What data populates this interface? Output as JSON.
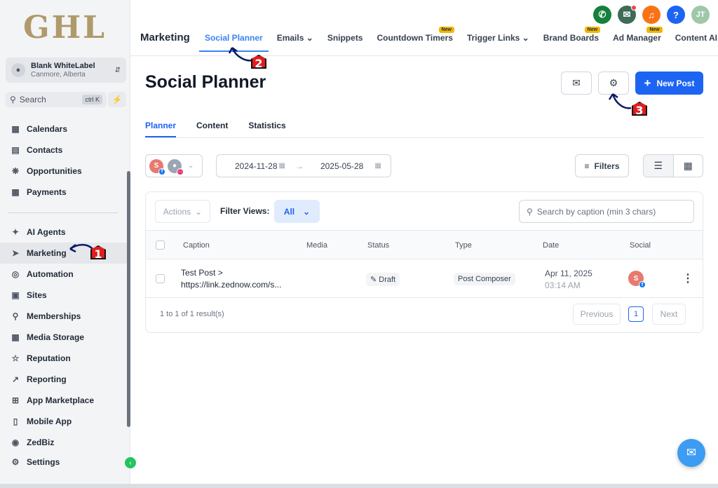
{
  "sidebar": {
    "logo": "GHL",
    "account": {
      "name": "Blank WhiteLabel",
      "location": "Canmore, Alberta"
    },
    "search": {
      "label": "Search",
      "shortcut": "ctrl K"
    },
    "items": [
      {
        "label": "Calendars",
        "icon": "calendar-icon"
      },
      {
        "label": "Contacts",
        "icon": "contacts-icon"
      },
      {
        "label": "Opportunities",
        "icon": "opportunities-icon"
      },
      {
        "label": "Payments",
        "icon": "payments-icon"
      },
      {
        "label": "AI Agents",
        "icon": "sparkle-icon"
      },
      {
        "label": "Marketing",
        "icon": "send-icon"
      },
      {
        "label": "Automation",
        "icon": "automation-icon"
      },
      {
        "label": "Sites",
        "icon": "sites-icon"
      },
      {
        "label": "Memberships",
        "icon": "award-icon"
      },
      {
        "label": "Media Storage",
        "icon": "image-icon"
      },
      {
        "label": "Reputation",
        "icon": "star-icon"
      },
      {
        "label": "Reporting",
        "icon": "trend-icon"
      },
      {
        "label": "App Marketplace",
        "icon": "grid-icon"
      },
      {
        "label": "Mobile App",
        "icon": "mobile-icon"
      },
      {
        "label": "ZedBiz",
        "icon": "zedbiz-icon"
      },
      {
        "label": "Settings",
        "icon": "gear-icon"
      }
    ]
  },
  "topbar": {
    "section": "Marketing",
    "tabs": [
      {
        "label": "Social Planner"
      },
      {
        "label": "Emails"
      },
      {
        "label": "Snippets"
      },
      {
        "label": "Countdown Timers",
        "badge": "New"
      },
      {
        "label": "Trigger Links"
      },
      {
        "label": "Brand Boards",
        "badge": "New"
      },
      {
        "label": "Ad Manager",
        "badge": "New"
      },
      {
        "label": "Content AI"
      }
    ],
    "user_initials": "JT",
    "help": "?"
  },
  "main": {
    "title": "Social Planner",
    "new_post": "New Post",
    "subtabs": [
      "Planner",
      "Content",
      "Statistics"
    ],
    "date_from": "2024-11-28",
    "date_to": "2025-05-28",
    "filters": "Filters",
    "actions": "Actions",
    "filter_views_label": "Filter Views:",
    "filter_views_value": "All",
    "caption_search_placeholder": "Search by caption (min 3 chars)",
    "columns": [
      "Caption",
      "Media",
      "Status",
      "Type",
      "Date",
      "Social"
    ],
    "rows": [
      {
        "caption_line1": "Test Post >",
        "caption_line2": "https://link.zednow.com/s...",
        "status": "Draft",
        "type": "Post Composer",
        "date": "Apr 11, 2025",
        "time": "03:14 AM",
        "avatar": "S"
      }
    ],
    "pager": {
      "info": "1 to 1 of 1 result(s)",
      "previous": "Previous",
      "page": "1",
      "next": "Next"
    }
  },
  "annotations": [
    "1",
    "2",
    "3"
  ],
  "colors": {
    "accent": "#1d64f2",
    "active_tab": "#3b82f6",
    "marker": "#e11d1d",
    "arrow": "#0b1a66"
  }
}
